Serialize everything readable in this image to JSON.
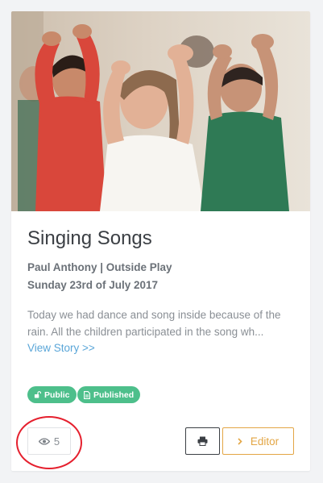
{
  "story": {
    "title": "Singing Songs",
    "author_line": "Paul Anthony | Outside Play",
    "date": "Sunday 23rd of July 2017",
    "excerpt": "Today we had dance and song inside because of the rain. All the children participated in the song wh...",
    "view_link": "View Story >>",
    "image": "children-singing-photo"
  },
  "badges": {
    "public": {
      "label": "Public",
      "icon": "unlock-icon"
    },
    "published": {
      "label": "Published",
      "icon": "document-icon"
    }
  },
  "footer": {
    "views": "5",
    "views_icon": "eye-icon",
    "print_icon": "printer-icon",
    "editor_label": "Editor",
    "editor_icon": "chevron-right-icon"
  },
  "colors": {
    "accent_green": "#4dbf8b",
    "accent_orange": "#e3a645",
    "link_blue": "#5aa6d8",
    "annotation_red": "#e5202e"
  }
}
